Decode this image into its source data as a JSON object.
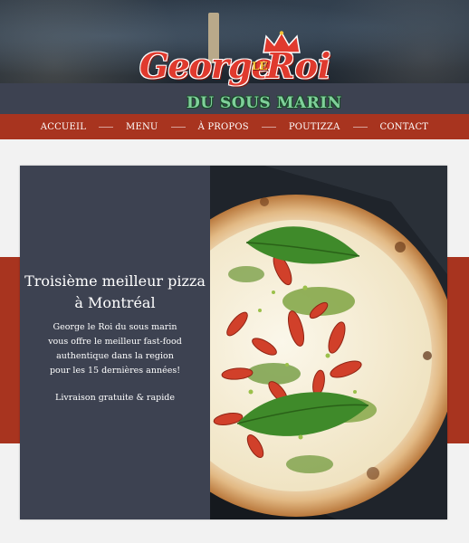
{
  "brand": {
    "logo_name_first": "George",
    "logo_name_le": "LE",
    "logo_name_last": "Roi",
    "logo_subtitle": "DU SOUS MARIN"
  },
  "nav": {
    "items": [
      {
        "label": "ACCUEIL"
      },
      {
        "label": "MENU"
      },
      {
        "label": "À PROPOS"
      },
      {
        "label": "POUTIZZA"
      },
      {
        "label": "CONTACT"
      }
    ]
  },
  "hero": {
    "title_line1": "Troisième meilleur pizza",
    "title_line2": "à Montréal",
    "desc_lines": [
      "George le Roi du sous marin",
      "vous offre  le meilleur fast-food",
      "authentique dans la region",
      "pour les 15 dernières années!"
    ],
    "cta": "Livraison gratuite & rapide",
    "image": "pizza-photo"
  },
  "colors": {
    "brand_red": "#a8341f",
    "panel_slate": "#3d4251",
    "page_bg": "#f2f2f2",
    "logo_red": "#e03a2e",
    "logo_green": "#7fd09a"
  }
}
